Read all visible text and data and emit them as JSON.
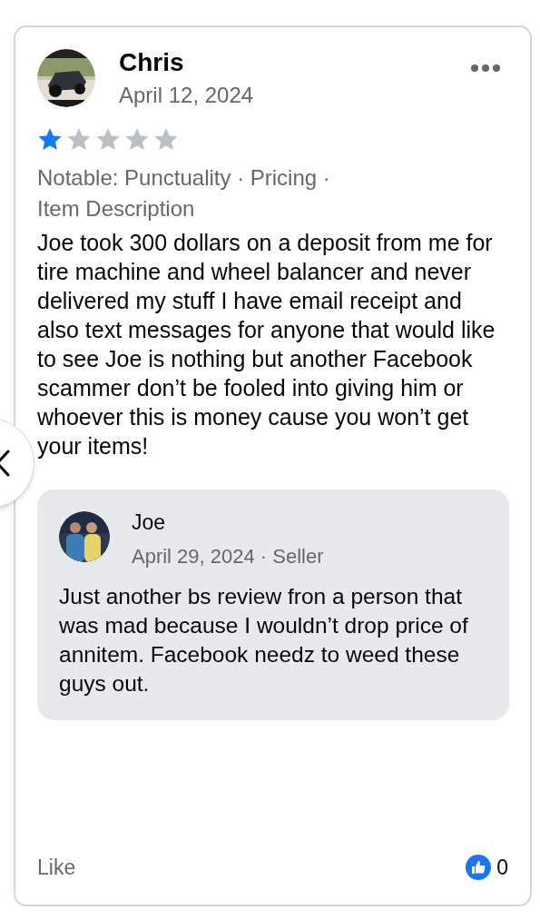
{
  "review": {
    "author": "Chris",
    "date": "April 12, 2024",
    "stars": 1,
    "notable": "Notable: Punctuality · Pricing · Item Description",
    "text": "Joe took 300 dollars on a deposit from me for tire machine and wheel balancer and never delivered my stuff I have email receipt and also text messages for anyone that would like to see Joe is nothing but another Facebook scammer don’t be fooled into giving him or whoever this is money cause you won’t get your items!"
  },
  "reply": {
    "author": "Joe",
    "meta": "April 29, 2024 · Seller",
    "text": "Just another bs review fron a person that was mad because I wouldn’t drop price of annitem. Facebook needz to weed these guys out."
  },
  "footer": {
    "like_label": "Like",
    "like_count": "0"
  }
}
